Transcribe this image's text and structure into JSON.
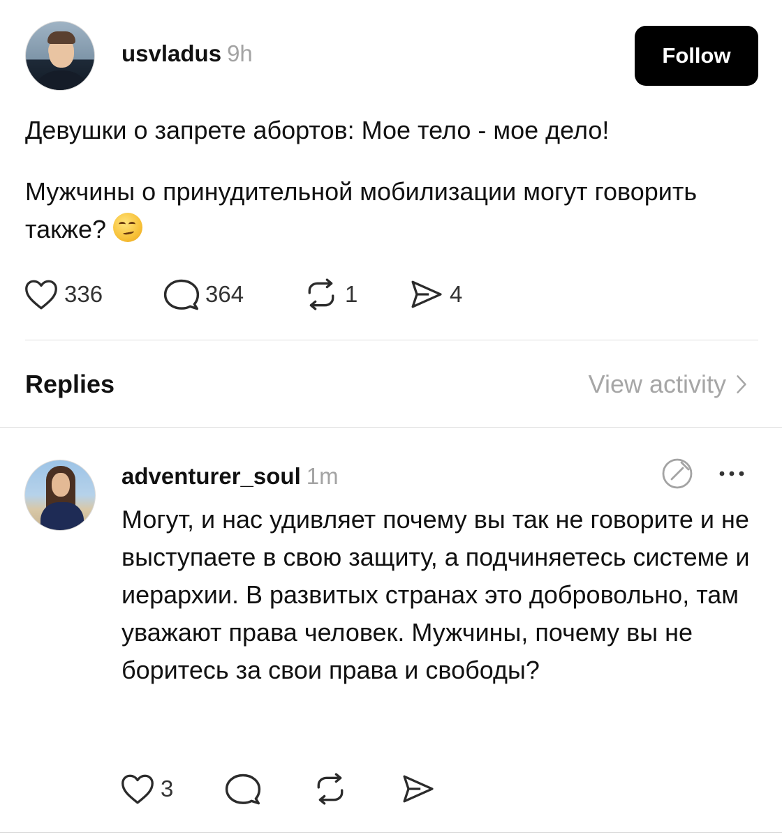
{
  "post": {
    "username": "usvladus",
    "time": "9h",
    "follow_label": "Follow",
    "paragraph1": "Девушки о запрете абортов: Мое тело - мое дело!",
    "paragraph2": "Мужчины о принудительной мобилизации могут говорить также?",
    "emoji": "smirking-face",
    "likes": "336",
    "comments": "364",
    "reposts": "1",
    "shares": "4"
  },
  "replies_header": {
    "title": "Replies",
    "view_activity": "View activity"
  },
  "reply": {
    "username": "adventurer_soul",
    "time": "1m",
    "text": "Могут, и нас удивляет почему вы так не говорите и не выступаете в свою защиту, а подчиняетесь системе и иерархии. В развитых странах это добровольно, там уважают права человек. Мужчины, почему вы не боритесь за свои права и свободы?",
    "likes": "3"
  },
  "icons": {
    "like": "heart-icon",
    "comment": "comment-icon",
    "repost": "repost-icon",
    "share": "share-icon",
    "edit": "edit-icon",
    "more": "more-icon",
    "chevron": "chevron-right-icon"
  },
  "colors": {
    "text": "#111111",
    "muted": "#a3a3a3",
    "button_bg": "#000000",
    "divider": "#dcdcdc"
  }
}
